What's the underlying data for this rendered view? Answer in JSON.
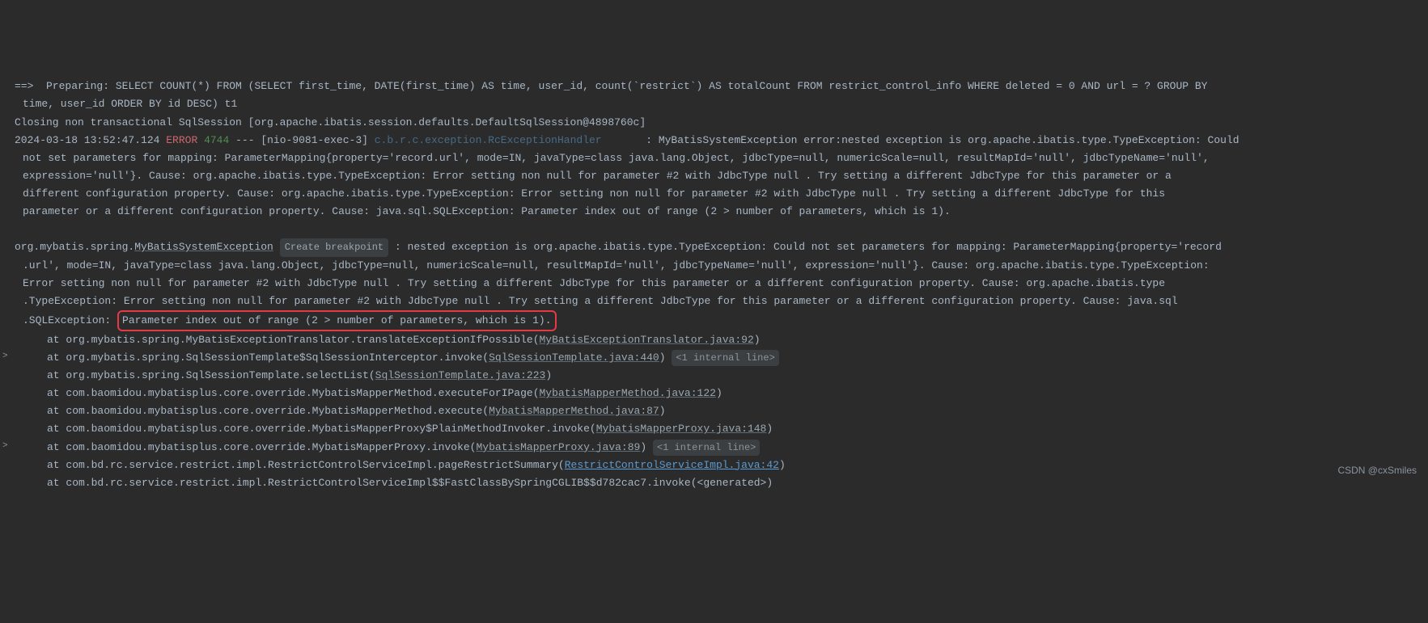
{
  "log": {
    "line1_prefix": "==>  Preparing: ",
    "line1_sql": "SELECT COUNT(*) FROM (SELECT first_time, DATE(first_time) AS time, user_id, count(`restrict`) AS totalCount FROM restrict_control_info WHERE deleted = 0 AND url = ? GROUP BY",
    "line1_cont": "time, user_id ORDER BY id DESC) t1",
    "line2": "Closing non transactional SqlSession [org.apache.ibatis.session.defaults.DefaultSqlSession@4898760c]",
    "ts": "2024-03-18 13:52:47.124",
    "level": "ERROR",
    "pid": "4744",
    "sep": " --- ",
    "thread": "[nio-9081-exec-3]",
    "logger": "c.b.r.c.exception.RcExceptionHandler",
    "msg_colon": "       : ",
    "msg1": "MyBatisSystemException error:nested exception is org.apache.ibatis.type.TypeException: Could",
    "msg2": "not set parameters for mapping: ParameterMapping{property='record.url', mode=IN, javaType=class java.lang.Object, jdbcType=null, numericScale=null, resultMapId='null', jdbcTypeName='null',",
    "msg3": "expression='null'}. Cause: org.apache.ibatis.type.TypeException: Error setting non null for parameter #2 with JdbcType null . Try setting a different JdbcType for this parameter or a",
    "msg4": "different configuration property. Cause: org.apache.ibatis.type.TypeException: Error setting non null for parameter #2 with JdbcType null . Try setting a different JdbcType for this",
    "msg5": "parameter or a different configuration property. Cause: java.sql.SQLException: Parameter index out of range (2 > number of parameters, which is 1)."
  },
  "ex": {
    "pkg": "org.mybatis.spring.",
    "class": "MyBatisSystemException",
    "badge": "Create breakpoint",
    "tail1": " : nested exception is org.apache.ibatis.type.TypeException: Could not set parameters for mapping: ParameterMapping{property='record",
    "l2": ".url', mode=IN, javaType=class java.lang.Object, jdbcType=null, numericScale=null, resultMapId='null', jdbcTypeName='null', expression='null'}. Cause: org.apache.ibatis.type.TypeException:",
    "l3": "Error setting non null for parameter #2 with JdbcType null . Try setting a different JdbcType for this parameter or a different configuration property. Cause: org.apache.ibatis.type",
    "l4": ".TypeException: Error setting non null for parameter #2 with JdbcType null . Try setting a different JdbcType for this parameter or a different configuration property. Cause: java.sql",
    "l5a": ".SQLException: ",
    "l5_box": "Parameter index out of range (2 > number of parameters, which is 1)."
  },
  "stack": [
    {
      "pre": "at org.mybatis.spring.MyBatisExceptionTranslator.translateExceptionIfPossible(",
      "link": "MyBatisExceptionTranslator.java:92",
      "post": ")",
      "active": false,
      "arrow": false,
      "internal": ""
    },
    {
      "pre": "at org.mybatis.spring.SqlSessionTemplate$SqlSessionInterceptor.invoke(",
      "link": "SqlSessionTemplate.java:440",
      "post": ")",
      "active": false,
      "arrow": true,
      "internal": "<1 internal line>"
    },
    {
      "pre": "at org.mybatis.spring.SqlSessionTemplate.selectList(",
      "link": "SqlSessionTemplate.java:223",
      "post": ")",
      "active": false,
      "arrow": false,
      "internal": ""
    },
    {
      "pre": "at com.baomidou.mybatisplus.core.override.MybatisMapperMethod.executeForIPage(",
      "link": "MybatisMapperMethod.java:122",
      "post": ")",
      "active": false,
      "arrow": false,
      "internal": ""
    },
    {
      "pre": "at com.baomidou.mybatisplus.core.override.MybatisMapperMethod.execute(",
      "link": "MybatisMapperMethod.java:87",
      "post": ")",
      "active": false,
      "arrow": false,
      "internal": ""
    },
    {
      "pre": "at com.baomidou.mybatisplus.core.override.MybatisMapperProxy$PlainMethodInvoker.invoke(",
      "link": "MybatisMapperProxy.java:148",
      "post": ")",
      "active": false,
      "arrow": false,
      "internal": ""
    },
    {
      "pre": "at com.baomidou.mybatisplus.core.override.MybatisMapperProxy.invoke(",
      "link": "MybatisMapperProxy.java:89",
      "post": ")",
      "active": false,
      "arrow": true,
      "internal": "<1 internal line>"
    },
    {
      "pre": "at com.bd.rc.service.restrict.impl.RestrictControlServiceImpl.pageRestrictSummary(",
      "link": "RestrictControlServiceImpl.java:42",
      "post": ")",
      "active": true,
      "arrow": false,
      "internal": ""
    },
    {
      "pre": "at com.bd.rc.service.restrict.impl.RestrictControlServiceImpl$$FastClassBySpringCGLIB$$d782cac7.invoke(<generated>)",
      "link": "",
      "post": "",
      "active": false,
      "arrow": false,
      "internal": ""
    }
  ],
  "watermark": "CSDN @cxSmiles"
}
